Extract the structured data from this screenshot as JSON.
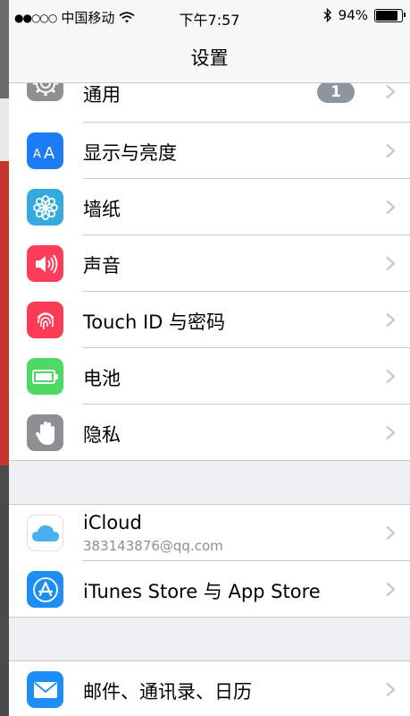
{
  "status_bar": {
    "signal": "●●○○○",
    "carrier": "中国移动",
    "time": "下午7:57",
    "battery_percent": "94%",
    "battery_level": 0.94
  },
  "nav": {
    "title": "设置"
  },
  "groups": [
    {
      "rows": [
        {
          "label": "通用",
          "badge": "1",
          "icon": "gear-icon",
          "color": "#8e8e93"
        },
        {
          "label": "显示与亮度",
          "icon": "aa-icon",
          "color": "#1c7cf4"
        },
        {
          "label": "墙纸",
          "icon": "flower-icon",
          "color": "#35aadc"
        },
        {
          "label": "声音",
          "icon": "speaker-icon",
          "color": "#fd3d5a"
        },
        {
          "label": "Touch ID 与密码",
          "icon": "fingerprint-icon",
          "color": "#fd3b54"
        },
        {
          "label": "电池",
          "icon": "battery-icon",
          "color": "#4cd964"
        },
        {
          "label": "隐私",
          "icon": "hand-icon",
          "color": "#8e8e93"
        }
      ]
    },
    {
      "rows": [
        {
          "label": "iCloud",
          "sublabel": "383143876@qq.com",
          "icon": "cloud-icon",
          "color": "#ffffff"
        },
        {
          "label": "iTunes Store 与 App Store",
          "icon": "app-store-icon",
          "color": "#1d8ef5"
        }
      ]
    },
    {
      "rows": [
        {
          "label": "邮件、通讯录、日历",
          "icon": "mail-icon",
          "color": "#1e8ef7"
        }
      ]
    }
  ]
}
